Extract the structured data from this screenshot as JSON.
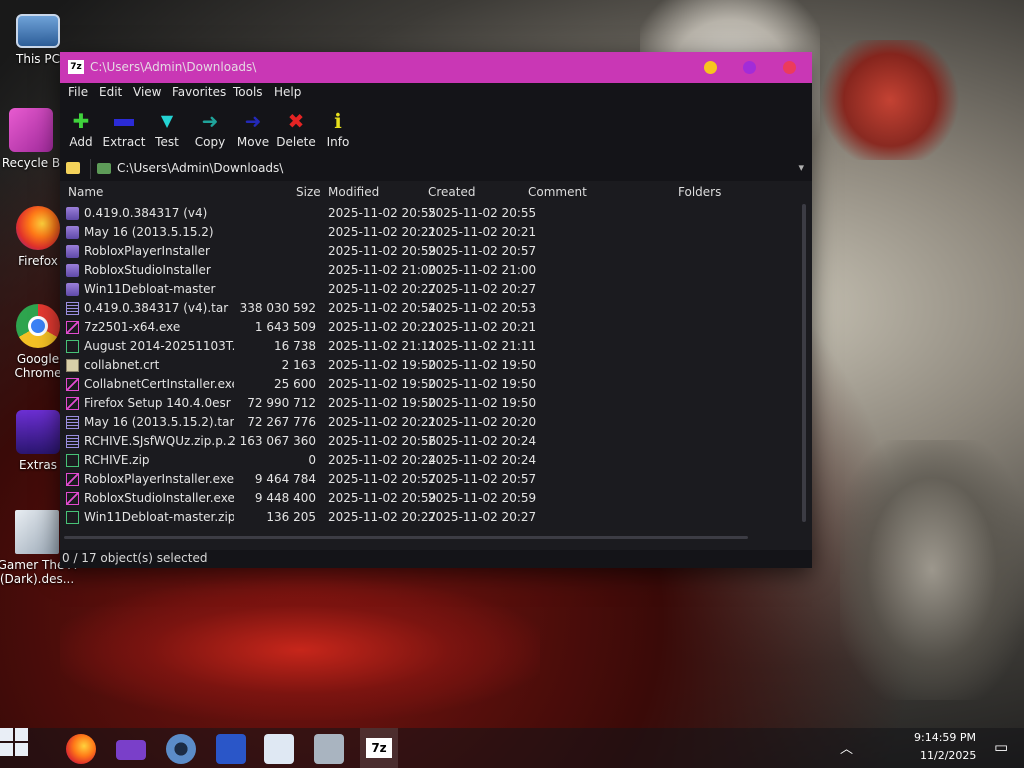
{
  "desktop": {
    "icons": [
      {
        "label": "This PC"
      },
      {
        "label": "Recycle B"
      },
      {
        "label": "Firefox"
      },
      {
        "label": "Google Chrome"
      },
      {
        "label": "Extras"
      },
      {
        "label": "Gamer The A (Dark).des..."
      }
    ]
  },
  "window": {
    "title": "C:\\Users\\Admin\\Downloads\\",
    "app_icon_text": "7z",
    "colors": {
      "titlebar": "#c937b5",
      "minimize": "#f7c51e",
      "maximize": "#a22cd8",
      "close": "#ec3b5c"
    }
  },
  "menu": [
    "File",
    "Edit",
    "View",
    "Favorites",
    "Tools",
    "Help"
  ],
  "toolbar": [
    {
      "label": "Add",
      "icon": "plus-icon"
    },
    {
      "label": "Extract",
      "icon": "minus-icon"
    },
    {
      "label": "Test",
      "icon": "check-icon"
    },
    {
      "label": "Copy",
      "icon": "arrow-right-icon"
    },
    {
      "label": "Move",
      "icon": "arrow-right-icon"
    },
    {
      "label": "Delete",
      "icon": "x-icon"
    },
    {
      "label": "Info",
      "icon": "info-icon"
    }
  ],
  "address": {
    "path": "C:\\Users\\Admin\\Downloads\\"
  },
  "columns": [
    "Name",
    "Size",
    "Modified",
    "Created",
    "Comment",
    "Folders"
  ],
  "files": [
    {
      "name": "0.419.0.384317 (v4)",
      "size": "",
      "modified": "2025-11-02 20:55",
      "created": "2025-11-02 20:55",
      "type": "folder"
    },
    {
      "name": "May 16 (2013.5.15.2)",
      "size": "",
      "modified": "2025-11-02 20:21",
      "created": "2025-11-02 20:21",
      "type": "folder"
    },
    {
      "name": "RobloxPlayerInstaller",
      "size": "",
      "modified": "2025-11-02 20:59",
      "created": "2025-11-02 20:57",
      "type": "folder"
    },
    {
      "name": "RobloxStudioInstaller",
      "size": "",
      "modified": "2025-11-02 21:00",
      "created": "2025-11-02 21:00",
      "type": "folder"
    },
    {
      "name": "Win11Debloat-master",
      "size": "",
      "modified": "2025-11-02 20:27",
      "created": "2025-11-02 20:27",
      "type": "folder"
    },
    {
      "name": "0.419.0.384317 (v4).tar",
      "size": "338 030 592",
      "modified": "2025-11-02 20:54",
      "created": "2025-11-02 20:53",
      "type": "tar"
    },
    {
      "name": "7z2501-x64.exe",
      "size": "1 643 509",
      "modified": "2025-11-02 20:21",
      "created": "2025-11-02 20:21",
      "type": "exe"
    },
    {
      "name": "August 2014-20251103T...",
      "size": "16 738",
      "modified": "2025-11-02 21:11",
      "created": "2025-11-02 21:11",
      "type": "zip"
    },
    {
      "name": "collabnet.crt",
      "size": "2 163",
      "modified": "2025-11-02 19:50",
      "created": "2025-11-02 19:50",
      "type": "crt"
    },
    {
      "name": "CollabnetCertInstaller.exe",
      "size": "25 600",
      "modified": "2025-11-02 19:50",
      "created": "2025-11-02 19:50",
      "type": "exe"
    },
    {
      "name": "Firefox Setup 140.4.0esr ...",
      "size": "72 990 712",
      "modified": "2025-11-02 19:50",
      "created": "2025-11-02 19:50",
      "type": "exe"
    },
    {
      "name": "May 16 (2013.5.15.2).tar",
      "size": "72 267 776",
      "modified": "2025-11-02 20:21",
      "created": "2025-11-02 20:20",
      "type": "tar"
    },
    {
      "name": "RCHIVE.SJsfWQUz.zip.p...",
      "size": "2 163 067 360",
      "modified": "2025-11-02 20:56",
      "created": "2025-11-02 20:24",
      "type": "tar"
    },
    {
      "name": "RCHIVE.zip",
      "size": "0",
      "modified": "2025-11-02 20:24",
      "created": "2025-11-02 20:24",
      "type": "zip"
    },
    {
      "name": "RobloxPlayerInstaller.exe",
      "size": "9 464 784",
      "modified": "2025-11-02 20:57",
      "created": "2025-11-02 20:57",
      "type": "exe"
    },
    {
      "name": "RobloxStudioInstaller.exe",
      "size": "9 448 400",
      "modified": "2025-11-02 20:59",
      "created": "2025-11-02 20:59",
      "type": "exe"
    },
    {
      "name": "Win11Debloat-master.zip",
      "size": "136 205",
      "modified": "2025-11-02 20:27",
      "created": "2025-11-02 20:27",
      "type": "zip"
    }
  ],
  "status": "0 / 17 object(s) selected",
  "taskbar": {
    "apps": [
      "windows-start",
      "firefox",
      "file-explorer",
      "settings",
      "powershell",
      "task-manager",
      "network-app",
      "7-zip"
    ],
    "clock_time": "9:14:59 PM",
    "clock_date": "11/2/2025"
  }
}
